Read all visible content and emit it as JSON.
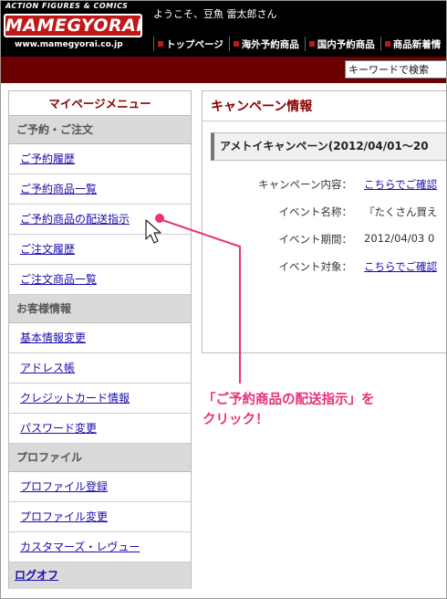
{
  "header": {
    "logo_tagline": "ACTION FIGURES & COMICS",
    "logo_name": "MAMEGYORAI",
    "logo_url": "www.mamegyorai.co.jp",
    "welcome": "ようこそ、豆魚 雷太郎さん",
    "nav": [
      "トップページ",
      "海外予約商品",
      "国内予約商品",
      "商品新着情"
    ]
  },
  "search": {
    "value": "キーワードで検索"
  },
  "sidebar": {
    "title": "マイページメニュー",
    "sections": [
      {
        "label": "ご予約・ご注文",
        "items": [
          "ご予約履歴",
          "ご予約商品一覧",
          "ご予約商品の配送指示",
          "ご注文履歴",
          "ご注文商品一覧"
        ]
      },
      {
        "label": "お客様情報",
        "items": [
          "基本情報変更",
          "アドレス帳",
          "クレジットカード情報",
          "パスワード変更"
        ]
      },
      {
        "label": "プロファイル",
        "items": [
          "プロファイル登録",
          "プロファイル変更",
          "カスタマーズ・レヴュー"
        ]
      }
    ],
    "logoff": "ログオフ"
  },
  "main": {
    "title": "キャンペーン情報",
    "campaign_name": "アメトイキャンペーン(2012/04/01〜20",
    "details": [
      {
        "label": "キャンペーン内容：",
        "value": "こちらでご確認"
      },
      {
        "label": "イベント名称：",
        "value": "『たくさん買え"
      },
      {
        "label": "イベント期間：",
        "value": "2012/04/03 0"
      },
      {
        "label": "イベント対象：",
        "value": "こちらでご確認"
      }
    ]
  },
  "annotation": {
    "line1": "「ご予約商品の配送指示」を",
    "line2": "クリック！",
    "color": "#e8317a"
  }
}
